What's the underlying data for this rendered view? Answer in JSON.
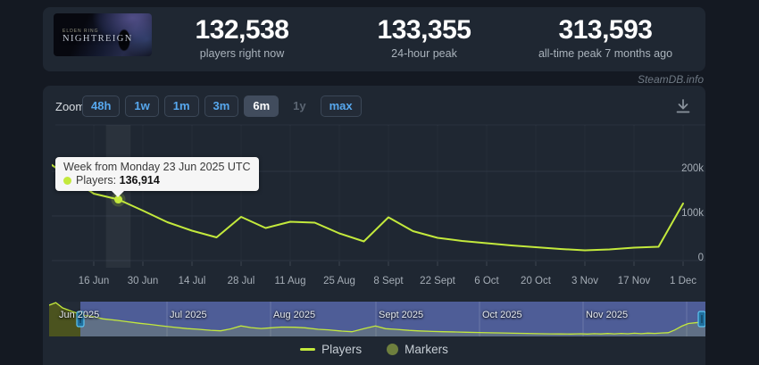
{
  "header": {
    "game": {
      "line1": "ELDEN RING",
      "line2": "NIGHTREIGN"
    },
    "stats": [
      {
        "value": "132,538",
        "label": "players right now"
      },
      {
        "value": "133,355",
        "label": "24-hour peak"
      },
      {
        "value": "313,593",
        "label": "all-time peak 7 months ago"
      }
    ]
  },
  "credit": "SteamDB.info",
  "toolbar": {
    "zoom_label": "Zoom",
    "buttons": [
      {
        "label": "48h",
        "state": "normal"
      },
      {
        "label": "1w",
        "state": "normal"
      },
      {
        "label": "1m",
        "state": "normal"
      },
      {
        "label": "3m",
        "state": "normal"
      },
      {
        "label": "6m",
        "state": "selected"
      },
      {
        "label": "1y",
        "state": "disabled"
      },
      {
        "label": "max",
        "state": "normal"
      }
    ]
  },
  "tooltip": {
    "title": "Week from Monday 23 Jun 2025 UTC",
    "series_label": "Players:",
    "value": "136,914"
  },
  "legend": [
    {
      "label": "Players",
      "swatch": "line",
      "color": "#c3e93c"
    },
    {
      "label": "Markers",
      "swatch": "circle",
      "color": "#6e7f3e"
    }
  ],
  "chart_data": {
    "type": "line",
    "title": "Player count history (6 month zoom)",
    "line_color": "#c3e93c",
    "series": [
      {
        "name": "Players",
        "x": [
          "2 Jun",
          "9 Jun",
          "16 Jun",
          "23 Jun",
          "30 Jun",
          "7 Jul",
          "14 Jul",
          "21 Jul",
          "28 Jul",
          "4 Aug",
          "11 Aug",
          "18 Aug",
          "25 Aug",
          "1 Sep",
          "8 Sep",
          "15 Sep",
          "22 Sep",
          "29 Sep",
          "6 Oct",
          "13 Oct",
          "20 Oct",
          "27 Oct",
          "3 Nov",
          "10 Nov",
          "17 Nov",
          "24 Nov",
          "1 Dec"
        ],
        "values": [
          225000,
          188000,
          150000,
          136914,
          112000,
          86000,
          67000,
          52000,
          98000,
          73000,
          87000,
          85000,
          61000,
          43000,
          97000,
          66000,
          51000,
          44000,
          39000,
          34000,
          30000,
          26000,
          23000,
          25000,
          29000,
          31000,
          128000
        ]
      }
    ],
    "highlight": {
      "x": "23 Jun",
      "index": 3,
      "value": 136914
    },
    "x_ticks": [
      "16 Jun",
      "30 Jun",
      "14 Jul",
      "28 Jul",
      "11 Aug",
      "25 Aug",
      "8 Sept",
      "22 Sept",
      "6 Oct",
      "20 Oct",
      "3 Nov",
      "17 Nov",
      "1 Dec"
    ],
    "y_ticks": [
      {
        "label": "200k",
        "value": 200000
      },
      {
        "label": "100k",
        "value": 100000
      },
      {
        "label": "0",
        "value": 0
      }
    ],
    "ylim": [
      0,
      300000
    ],
    "grid": true,
    "legend_position": "bottom",
    "navigator": {
      "months": [
        "Jun 2025",
        "Jul 2025",
        "Aug 2025",
        "Sept 2025",
        "Oct 2025",
        "Nov 2025"
      ],
      "max_value": 313593,
      "points": [
        [
          0,
          290000
        ],
        [
          2,
          313593
        ],
        [
          4,
          265000
        ],
        [
          7,
          230000
        ],
        [
          10,
          198000
        ],
        [
          13,
          185000
        ],
        [
          16,
          163000
        ],
        [
          20,
          150000
        ],
        [
          23,
          137000
        ],
        [
          27,
          122000
        ],
        [
          30,
          112000
        ],
        [
          34,
          96000
        ],
        [
          37,
          86000
        ],
        [
          41,
          73000
        ],
        [
          44,
          67000
        ],
        [
          48,
          57000
        ],
        [
          51,
          52000
        ],
        [
          54,
          70000
        ],
        [
          57,
          98000
        ],
        [
          60,
          82000
        ],
        [
          63,
          74000
        ],
        [
          66,
          80000
        ],
        [
          69,
          87000
        ],
        [
          73,
          85000
        ],
        [
          76,
          80000
        ],
        [
          80,
          66000
        ],
        [
          83,
          61000
        ],
        [
          87,
          50000
        ],
        [
          90,
          44000
        ],
        [
          94,
          75000
        ],
        [
          97,
          97000
        ],
        [
          100,
          72000
        ],
        [
          103,
          66000
        ],
        [
          107,
          56000
        ],
        [
          110,
          51000
        ],
        [
          114,
          46000
        ],
        [
          117,
          44000
        ],
        [
          121,
          41000
        ],
        [
          124,
          39000
        ],
        [
          128,
          36000
        ],
        [
          131,
          34000
        ],
        [
          135,
          32000
        ],
        [
          138,
          30000
        ],
        [
          142,
          28000
        ],
        [
          145,
          26000
        ],
        [
          149,
          24000
        ],
        [
          152,
          23000
        ],
        [
          155,
          22000
        ],
        [
          158,
          25000
        ],
        [
          160,
          22000
        ],
        [
          162,
          26000
        ],
        [
          164,
          23000
        ],
        [
          166,
          27000
        ],
        [
          168,
          24000
        ],
        [
          170,
          28000
        ],
        [
          172,
          25000
        ],
        [
          174,
          30000
        ],
        [
          176,
          26000
        ],
        [
          178,
          31000
        ],
        [
          180,
          28000
        ],
        [
          182,
          32000
        ],
        [
          184,
          35000
        ],
        [
          186,
          60000
        ],
        [
          188,
          95000
        ],
        [
          190,
          120000
        ],
        [
          193,
          130000
        ],
        [
          195,
          132000
        ]
      ]
    }
  }
}
